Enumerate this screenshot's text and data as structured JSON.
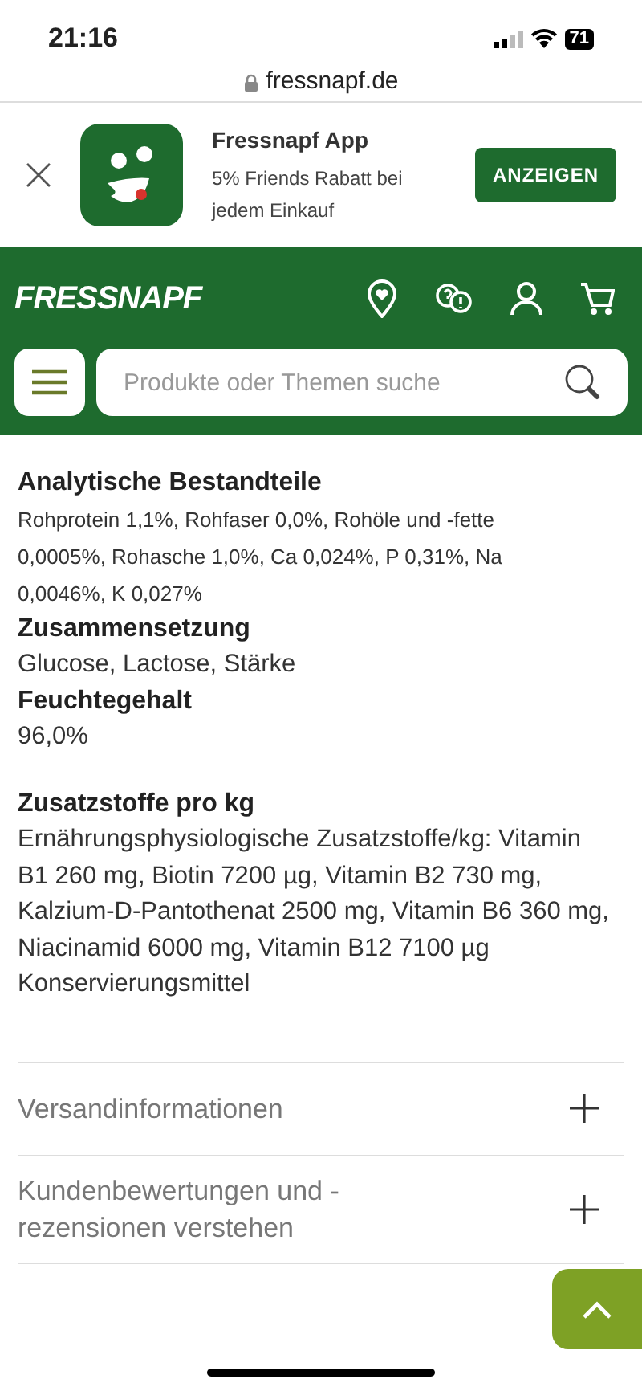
{
  "status_bar": {
    "time": "21:16",
    "battery": "71"
  },
  "browser": {
    "url": "fressnapf.de"
  },
  "app_banner": {
    "title": "Fressnapf App",
    "subtitle": "5% Friends Rabatt bei jedem Einkauf",
    "button": "ANZEIGEN"
  },
  "header": {
    "logo": "FRESSNAPF",
    "search": {
      "placeholder": "Produkte oder Themen suche"
    }
  },
  "sections": [
    {
      "heading": "Analytische Bestandteile",
      "text": "Rohprotein 1,1%, Rohfaser 0,0%, Rohöle und -fette 0,0005%, Rohasche 1,0%, Ca 0,024%, P 0,31%, Na 0,0046%, K 0,027%",
      "kind": "small"
    },
    {
      "heading": "Zusammensetzung",
      "text": "Glucose, Lactose, Stärke",
      "kind": "normal"
    },
    {
      "heading": "Feuchtegehalt",
      "text": "96,0%",
      "kind": "normal"
    },
    {
      "heading": "Zusatzstoffe pro kg",
      "text": "Ernährungsphysiologische Zusatzstoffe/kg: Vitamin B1 260 mg, Biotin 7200 µg, Vitamin B2 730 mg, Kalzium-D-Pantothenat 2500 mg, Vitamin B6 360 mg, Niacinamid 6000 mg, Vitamin B12 7100 µg Konservierungsmittel",
      "kind": "spaced"
    }
  ],
  "accordion": [
    {
      "title": "Versandinformationen",
      "expanded": false
    },
    {
      "title": "Kundenbewertungen und -rezensionen verstehen",
      "expanded": false
    }
  ]
}
